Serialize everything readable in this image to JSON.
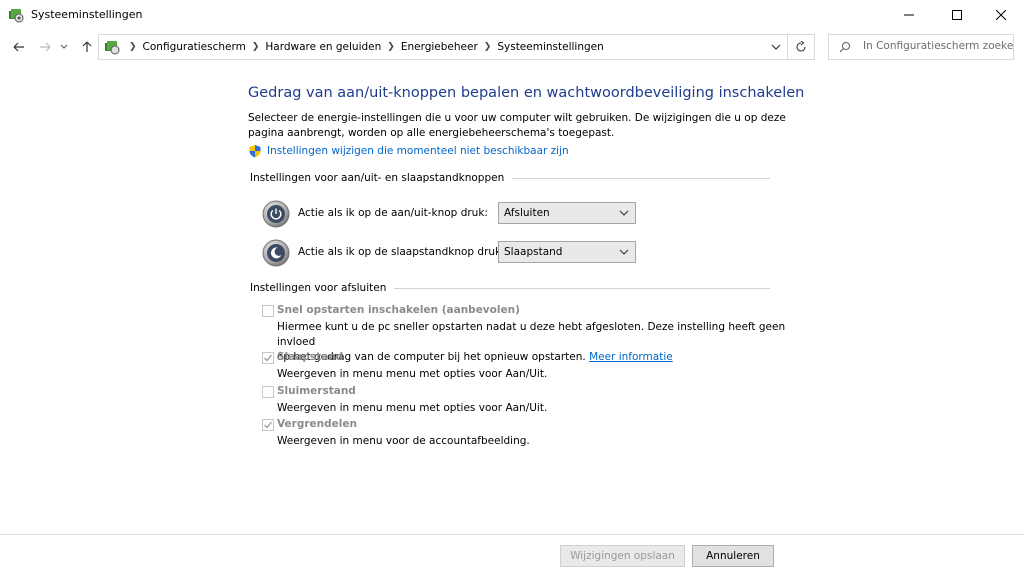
{
  "window": {
    "title": "Systeeminstellingen",
    "minimize": "—",
    "maximize": "☐",
    "close": "✕"
  },
  "address": {
    "crumbs": [
      "Configuratiescherm",
      "Hardware en geluiden",
      "Energiebeheer",
      "Systeeminstellingen"
    ],
    "search_placeholder": "In Configuratiescherm zoeken"
  },
  "main": {
    "title": "Gedrag van aan/uit-knoppen bepalen en wachtwoordbeveiliging inschakelen",
    "description": "Selecteer de energie-instellingen die u voor uw computer wilt gebruiken. De wijzigingen die u op deze pagina aanbrengt, worden op alle energiebeheerschema's toegepast.",
    "change_settings_link": "Instellingen wijzigen die momenteel niet beschikbaar zijn",
    "buttons_section": "Instellingen voor aan/uit- en slaapstandknoppen",
    "power_button_label": "Actie als ik op de aan/uit-knop druk:",
    "power_button_value": "Afsluiten",
    "sleep_button_label": "Actie als ik op de slaapstandknop druk:",
    "sleep_button_value": "Slaapstand",
    "shutdown_section": "Instellingen voor afsluiten",
    "options": [
      {
        "label": "Snel opstarten inschakelen (aanbevolen)",
        "checked": false,
        "desc_line1": "Hiermee kunt u de pc sneller opstarten nadat u deze hebt afgesloten. Deze instelling heeft geen invloed",
        "desc_line2": "op het gedrag van de computer bij het opnieuw opstarten.",
        "link": "Meer informatie"
      },
      {
        "label": "Slaapstand",
        "checked": true,
        "desc_line1": "Weergeven in menu menu met opties voor Aan/Uit."
      },
      {
        "label": "Sluimerstand",
        "checked": false,
        "desc_line1": "Weergeven in menu menu met opties voor Aan/Uit."
      },
      {
        "label": "Vergrendelen",
        "checked": true,
        "desc_line1": "Weergeven in menu voor de accountafbeelding."
      }
    ]
  },
  "footer": {
    "save_label": "Wijzigingen opslaan",
    "cancel_label": "Annuleren"
  }
}
